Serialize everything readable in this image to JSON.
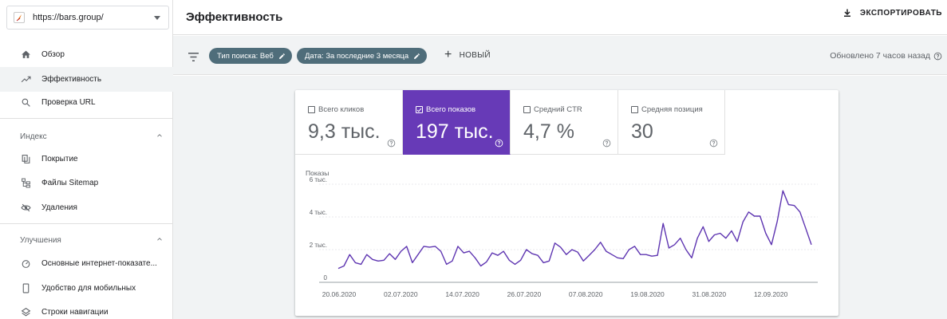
{
  "sidebar": {
    "property": {
      "url": "https://bars.group/"
    },
    "items": [
      {
        "label": "Обзор",
        "icon": "home-icon"
      },
      {
        "label": "Эффективность",
        "icon": "trending-up-icon",
        "active": true
      },
      {
        "label": "Проверка URL",
        "icon": "search-icon"
      }
    ],
    "sections": [
      {
        "title": "Индекс",
        "items": [
          {
            "label": "Покрытие",
            "icon": "file-copy-icon"
          },
          {
            "label": "Файлы Sitemap",
            "icon": "sitemap-icon"
          },
          {
            "label": "Удаления",
            "icon": "visibility-off-icon"
          }
        ]
      },
      {
        "title": "Улучшения",
        "items": [
          {
            "label": "Основные интернет-показате...",
            "icon": "speed-icon"
          },
          {
            "label": "Удобство для мобильных",
            "icon": "smartphone-icon"
          },
          {
            "label": "Строки навигации",
            "icon": "layers-icon"
          }
        ]
      }
    ]
  },
  "header": {
    "title": "Эффективность",
    "export_label": "ЭКСПОРТИРОВАТЬ"
  },
  "filters": {
    "chips": [
      "Тип поиска: Веб",
      "Дата: За последние 3 месяца"
    ],
    "new_label": "НОВЫЙ",
    "updated": "Обновлено 7 часов назад"
  },
  "metrics": [
    {
      "label": "Всего кликов",
      "value": "9,3 тыс.",
      "selected": false
    },
    {
      "label": "Всего показов",
      "value": "197 тыс.",
      "selected": true
    },
    {
      "label": "Средний CTR",
      "value": "4,7 %",
      "selected": false
    },
    {
      "label": "Средняя позиция",
      "value": "30",
      "selected": false
    }
  ],
  "colors": {
    "accent": "#673ab7",
    "chip": "#4f6d7a",
    "line": "#5e35b1"
  },
  "chart_data": {
    "type": "line",
    "ylabel": "Показы",
    "ylim": [
      0,
      6000
    ],
    "yticks": [
      {
        "value": 0,
        "label": "0"
      },
      {
        "value": 2000,
        "label": "2 тыс."
      },
      {
        "value": 4000,
        "label": "4 тыс."
      },
      {
        "value": 6000,
        "label": "6 тыс."
      }
    ],
    "xticks": [
      "20.06.2020",
      "02.07.2020",
      "14.07.2020",
      "26.07.2020",
      "07.08.2020",
      "19.08.2020",
      "31.08.2020",
      "12.09.2020"
    ],
    "series": [
      {
        "values": [
          850,
          1000,
          1700,
          1200,
          1100,
          1700,
          1400,
          1300,
          1350,
          1750,
          1400,
          1900,
          2200,
          1200,
          1700,
          2200,
          2150,
          2200,
          1900,
          1100,
          1300,
          2200,
          1800,
          1900,
          1500,
          1000,
          1250,
          1800,
          1650,
          1900,
          1350,
          1100,
          1350,
          2000,
          1750,
          1650,
          1200,
          1300,
          2400,
          2150,
          1700,
          2000,
          1850,
          1300,
          1650,
          2000,
          2450,
          1900,
          1700,
          1500,
          1450,
          2000,
          2200,
          1700,
          1700,
          1600,
          1650,
          3600,
          2100,
          2300,
          2700,
          2000,
          1500,
          2700,
          3400,
          2500,
          2900,
          3000,
          2700,
          3150,
          2500,
          3700,
          4300,
          4050,
          4050,
          3000,
          2300,
          3700,
          5600,
          4750,
          4700,
          4300,
          3300,
          2300
        ]
      }
    ]
  }
}
